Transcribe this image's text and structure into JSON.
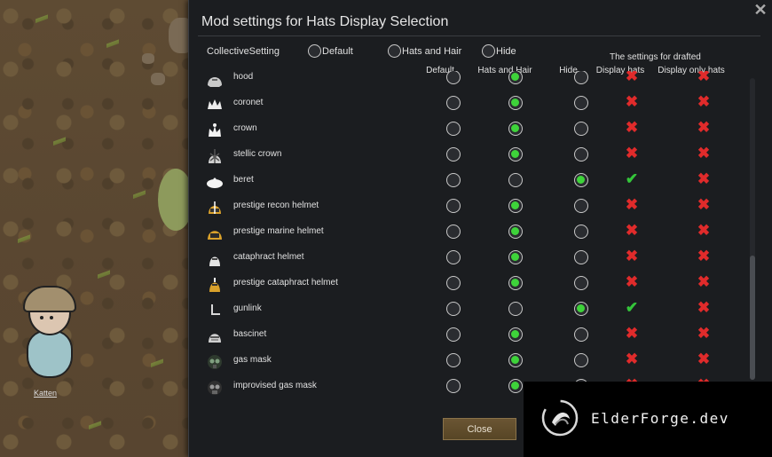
{
  "dialog": {
    "title": "Mod settings for Hats Display Selection",
    "close_icon": "close-icon",
    "collective_label": "CollectiveSetting",
    "collective_options": [
      "Default",
      "Hats and Hair",
      "Hide"
    ],
    "drafted_title": "The settings for drafted",
    "columns": {
      "default": "Default",
      "hats_and_hair": "Hats and Hair",
      "hide": "Hide",
      "display_hats": "Display hats",
      "display_only_hats": "Display only hats"
    },
    "close_button": "Close"
  },
  "hats": [
    {
      "name": "hood",
      "icon": "hood-icon",
      "selected": "hats_and_hair",
      "display_hats": false,
      "display_only_hats": false
    },
    {
      "name": "coronet",
      "icon": "coronet-icon",
      "selected": "hats_and_hair",
      "display_hats": false,
      "display_only_hats": false
    },
    {
      "name": "crown",
      "icon": "crown-icon",
      "selected": "hats_and_hair",
      "display_hats": false,
      "display_only_hats": false
    },
    {
      "name": "stellic crown",
      "icon": "stellic-crown-icon",
      "selected": "hats_and_hair",
      "display_hats": false,
      "display_only_hats": false
    },
    {
      "name": "beret",
      "icon": "beret-icon",
      "selected": "hide",
      "display_hats": true,
      "display_only_hats": false
    },
    {
      "name": "prestige recon helmet",
      "icon": "recon-helmet-icon",
      "selected": "hats_and_hair",
      "display_hats": false,
      "display_only_hats": false
    },
    {
      "name": "prestige marine helmet",
      "icon": "marine-helmet-icon",
      "selected": "hats_and_hair",
      "display_hats": false,
      "display_only_hats": false
    },
    {
      "name": "cataphract helmet",
      "icon": "cataphract-helmet-icon",
      "selected": "hats_and_hair",
      "display_hats": false,
      "display_only_hats": false
    },
    {
      "name": "prestige cataphract helmet",
      "icon": "prestige-cataphract-helmet-icon",
      "selected": "hats_and_hair",
      "display_hats": false,
      "display_only_hats": false
    },
    {
      "name": "gunlink",
      "icon": "gunlink-icon",
      "selected": "hide",
      "display_hats": true,
      "display_only_hats": false
    },
    {
      "name": "bascinet",
      "icon": "bascinet-icon",
      "selected": "hats_and_hair",
      "display_hats": false,
      "display_only_hats": false
    },
    {
      "name": "gas mask",
      "icon": "gas-mask-icon",
      "selected": "hats_and_hair",
      "display_hats": false,
      "display_only_hats": false
    },
    {
      "name": "improvised gas mask",
      "icon": "improvised-gas-mask-icon",
      "selected": "hats_and_hair",
      "display_hats": false,
      "display_only_hats": false
    }
  ],
  "pawn": {
    "name": "Katten"
  },
  "watermark": {
    "text": "ElderForge.dev",
    "logo": "elderforge-logo-icon"
  },
  "colors": {
    "on": "#3ed33a",
    "x": "#e02b2b",
    "check": "#34c53a",
    "panel": "#1b1d20"
  }
}
